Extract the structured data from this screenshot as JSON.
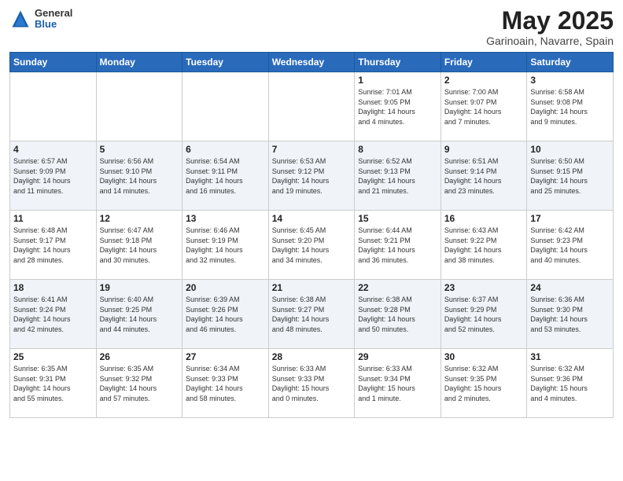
{
  "header": {
    "logo_general": "General",
    "logo_blue": "Blue",
    "month_title": "May 2025",
    "location": "Garinoain, Navarre, Spain"
  },
  "days_of_week": [
    "Sunday",
    "Monday",
    "Tuesday",
    "Wednesday",
    "Thursday",
    "Friday",
    "Saturday"
  ],
  "weeks": [
    [
      {
        "day": "",
        "info": ""
      },
      {
        "day": "",
        "info": ""
      },
      {
        "day": "",
        "info": ""
      },
      {
        "day": "",
        "info": ""
      },
      {
        "day": "1",
        "info": "Sunrise: 7:01 AM\nSunset: 9:05 PM\nDaylight: 14 hours\nand 4 minutes."
      },
      {
        "day": "2",
        "info": "Sunrise: 7:00 AM\nSunset: 9:07 PM\nDaylight: 14 hours\nand 7 minutes."
      },
      {
        "day": "3",
        "info": "Sunrise: 6:58 AM\nSunset: 9:08 PM\nDaylight: 14 hours\nand 9 minutes."
      }
    ],
    [
      {
        "day": "4",
        "info": "Sunrise: 6:57 AM\nSunset: 9:09 PM\nDaylight: 14 hours\nand 11 minutes."
      },
      {
        "day": "5",
        "info": "Sunrise: 6:56 AM\nSunset: 9:10 PM\nDaylight: 14 hours\nand 14 minutes."
      },
      {
        "day": "6",
        "info": "Sunrise: 6:54 AM\nSunset: 9:11 PM\nDaylight: 14 hours\nand 16 minutes."
      },
      {
        "day": "7",
        "info": "Sunrise: 6:53 AM\nSunset: 9:12 PM\nDaylight: 14 hours\nand 19 minutes."
      },
      {
        "day": "8",
        "info": "Sunrise: 6:52 AM\nSunset: 9:13 PM\nDaylight: 14 hours\nand 21 minutes."
      },
      {
        "day": "9",
        "info": "Sunrise: 6:51 AM\nSunset: 9:14 PM\nDaylight: 14 hours\nand 23 minutes."
      },
      {
        "day": "10",
        "info": "Sunrise: 6:50 AM\nSunset: 9:15 PM\nDaylight: 14 hours\nand 25 minutes."
      }
    ],
    [
      {
        "day": "11",
        "info": "Sunrise: 6:48 AM\nSunset: 9:17 PM\nDaylight: 14 hours\nand 28 minutes."
      },
      {
        "day": "12",
        "info": "Sunrise: 6:47 AM\nSunset: 9:18 PM\nDaylight: 14 hours\nand 30 minutes."
      },
      {
        "day": "13",
        "info": "Sunrise: 6:46 AM\nSunset: 9:19 PM\nDaylight: 14 hours\nand 32 minutes."
      },
      {
        "day": "14",
        "info": "Sunrise: 6:45 AM\nSunset: 9:20 PM\nDaylight: 14 hours\nand 34 minutes."
      },
      {
        "day": "15",
        "info": "Sunrise: 6:44 AM\nSunset: 9:21 PM\nDaylight: 14 hours\nand 36 minutes."
      },
      {
        "day": "16",
        "info": "Sunrise: 6:43 AM\nSunset: 9:22 PM\nDaylight: 14 hours\nand 38 minutes."
      },
      {
        "day": "17",
        "info": "Sunrise: 6:42 AM\nSunset: 9:23 PM\nDaylight: 14 hours\nand 40 minutes."
      }
    ],
    [
      {
        "day": "18",
        "info": "Sunrise: 6:41 AM\nSunset: 9:24 PM\nDaylight: 14 hours\nand 42 minutes."
      },
      {
        "day": "19",
        "info": "Sunrise: 6:40 AM\nSunset: 9:25 PM\nDaylight: 14 hours\nand 44 minutes."
      },
      {
        "day": "20",
        "info": "Sunrise: 6:39 AM\nSunset: 9:26 PM\nDaylight: 14 hours\nand 46 minutes."
      },
      {
        "day": "21",
        "info": "Sunrise: 6:38 AM\nSunset: 9:27 PM\nDaylight: 14 hours\nand 48 minutes."
      },
      {
        "day": "22",
        "info": "Sunrise: 6:38 AM\nSunset: 9:28 PM\nDaylight: 14 hours\nand 50 minutes."
      },
      {
        "day": "23",
        "info": "Sunrise: 6:37 AM\nSunset: 9:29 PM\nDaylight: 14 hours\nand 52 minutes."
      },
      {
        "day": "24",
        "info": "Sunrise: 6:36 AM\nSunset: 9:30 PM\nDaylight: 14 hours\nand 53 minutes."
      }
    ],
    [
      {
        "day": "25",
        "info": "Sunrise: 6:35 AM\nSunset: 9:31 PM\nDaylight: 14 hours\nand 55 minutes."
      },
      {
        "day": "26",
        "info": "Sunrise: 6:35 AM\nSunset: 9:32 PM\nDaylight: 14 hours\nand 57 minutes."
      },
      {
        "day": "27",
        "info": "Sunrise: 6:34 AM\nSunset: 9:33 PM\nDaylight: 14 hours\nand 58 minutes."
      },
      {
        "day": "28",
        "info": "Sunrise: 6:33 AM\nSunset: 9:33 PM\nDaylight: 15 hours\nand 0 minutes."
      },
      {
        "day": "29",
        "info": "Sunrise: 6:33 AM\nSunset: 9:34 PM\nDaylight: 15 hours\nand 1 minute."
      },
      {
        "day": "30",
        "info": "Sunrise: 6:32 AM\nSunset: 9:35 PM\nDaylight: 15 hours\nand 2 minutes."
      },
      {
        "day": "31",
        "info": "Sunrise: 6:32 AM\nSunset: 9:36 PM\nDaylight: 15 hours\nand 4 minutes."
      }
    ]
  ]
}
